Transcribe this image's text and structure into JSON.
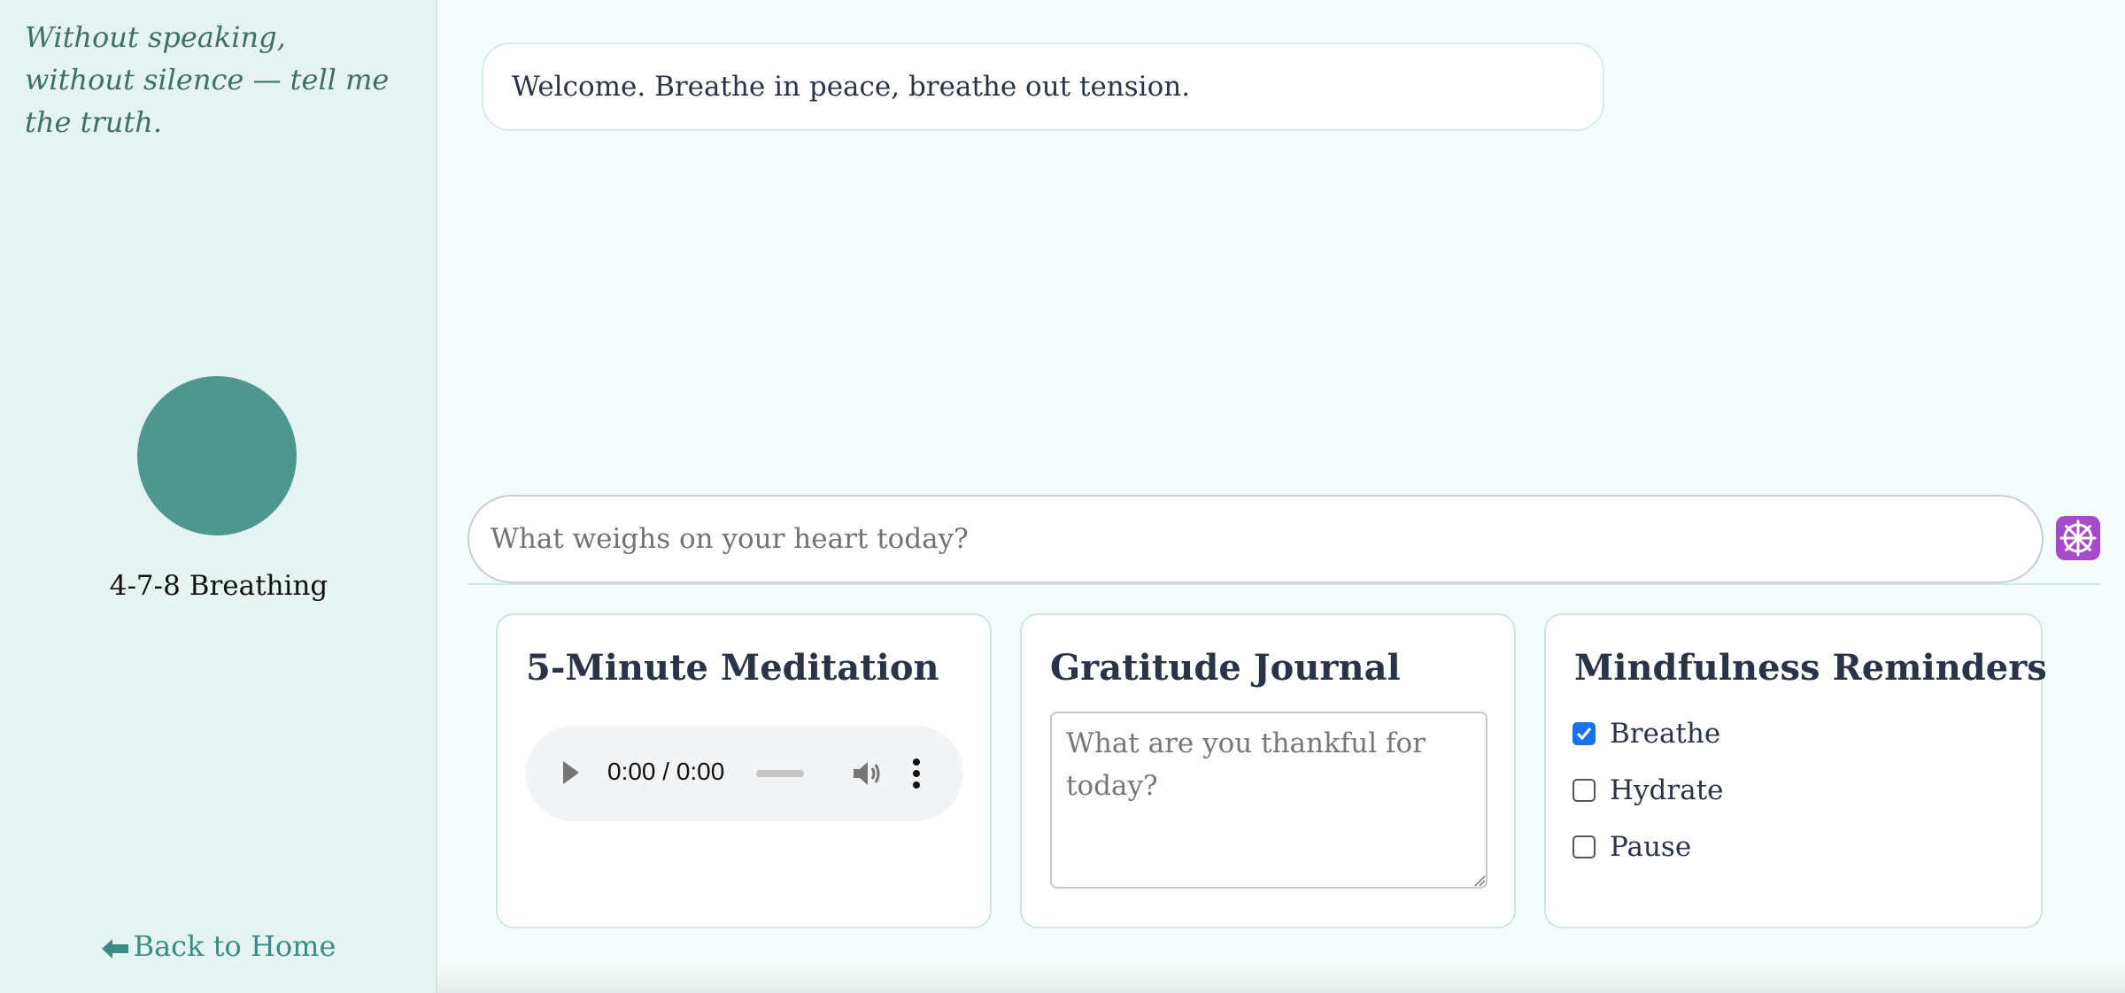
{
  "sidebar": {
    "quote": "Without speaking, without silence — tell me the truth.",
    "breathing_label": "4-7-8 Breathing",
    "back_link": "Back to Home",
    "back_icon": "arrow-left-icon"
  },
  "chat": {
    "welcome_message": "Welcome. Breathe in peace, breathe out tension.",
    "input_placeholder": "What weighs on your heart today?",
    "send_icon": "dharma-wheel-icon"
  },
  "cards": {
    "meditation": {
      "title": "5-Minute Meditation",
      "audio_time": "0:00 / 0:00"
    },
    "journal": {
      "title": "Gratitude Journal",
      "placeholder": "What are you thankful for today?"
    },
    "reminders": {
      "title": "Mindfulness Reminders",
      "items": [
        {
          "label": "Breathe",
          "checked": true
        },
        {
          "label": "Hydrate",
          "checked": false
        },
        {
          "label": "Pause",
          "checked": false
        }
      ]
    }
  },
  "colors": {
    "accent": "#4f968f",
    "sidebar_bg": "#e6f4f1",
    "page_bg": "#f4fbfa",
    "checkbox_checked": "#1a73e8",
    "send_button": "#a54ac9"
  }
}
